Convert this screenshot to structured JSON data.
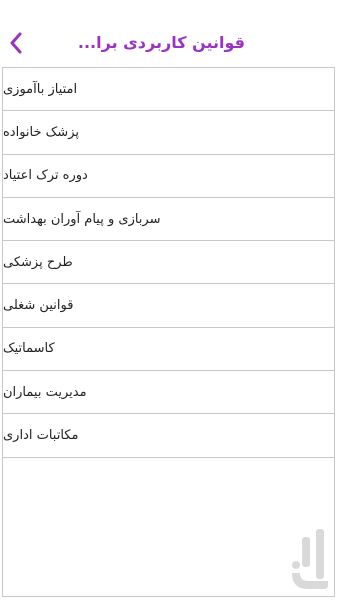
{
  "header": {
    "title": "قوانین کاربردی برا...",
    "back_icon": "chevron-left-icon",
    "title_color": "#9b33c2"
  },
  "list": {
    "items": [
      {
        "label": "امتیاز باآموزی"
      },
      {
        "label": "پزشک خانواده"
      },
      {
        "label": "دوره ترک اعتیاد"
      },
      {
        "label": "سربازی و پیام آوران بهداشت"
      },
      {
        "label": "طرح پزشکی"
      },
      {
        "label": "قوانین شغلی"
      },
      {
        "label": "کاسماتیک"
      },
      {
        "label": "مدیریت بیماران"
      },
      {
        "label": "مکاتبات اداری"
      }
    ]
  },
  "watermark": {
    "icon": "app-store-logo-icon"
  }
}
